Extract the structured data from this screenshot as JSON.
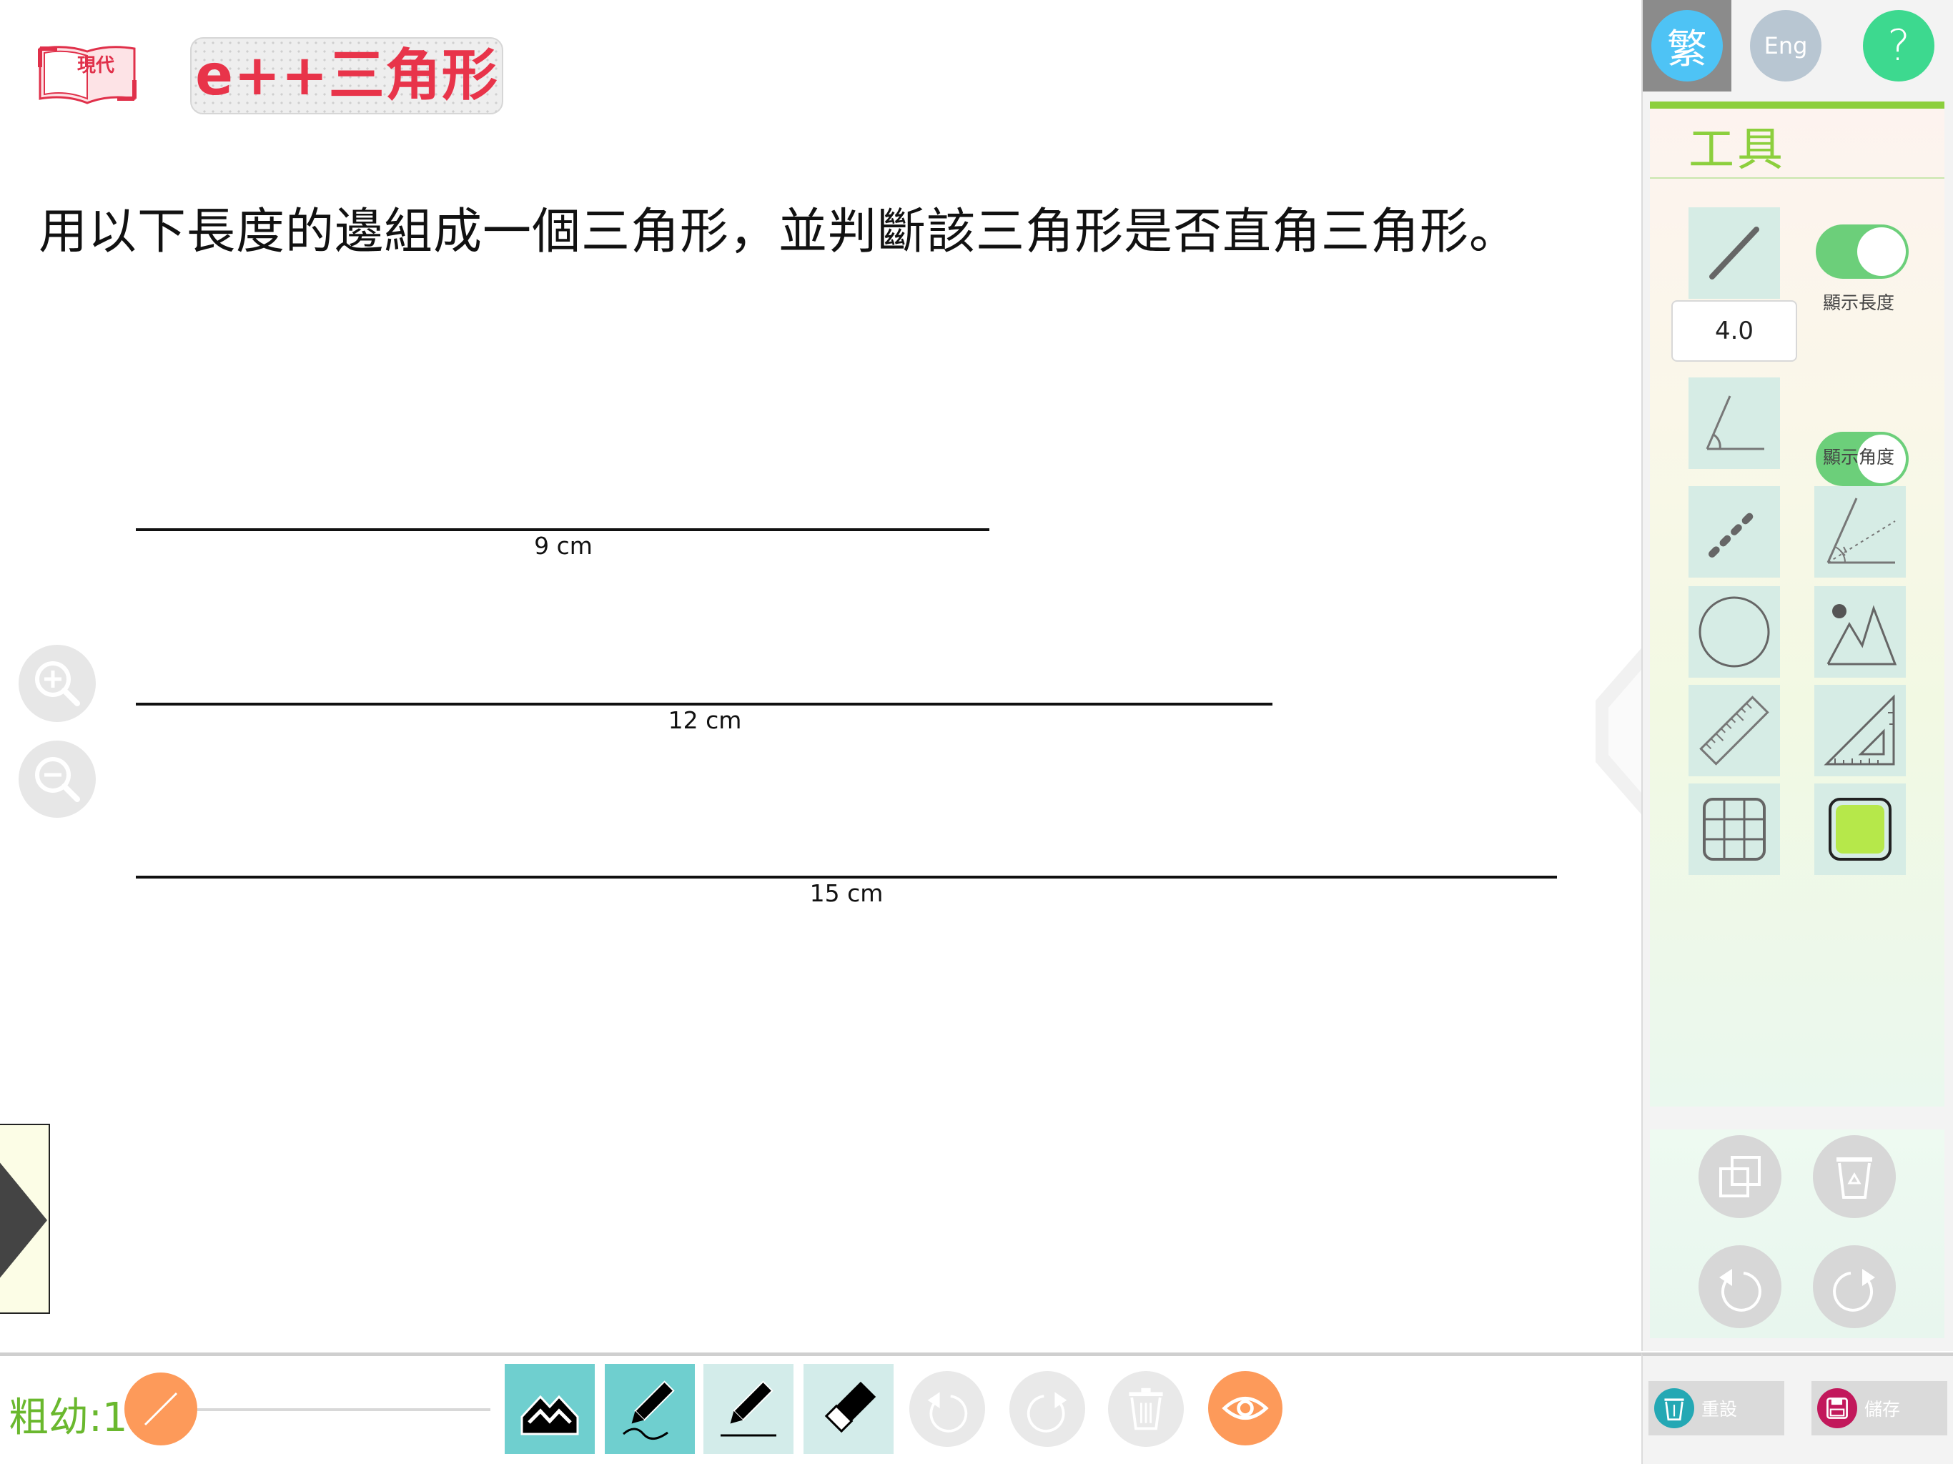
{
  "header": {
    "publisher_logo_text": "現代",
    "app_title_prefix": "e++",
    "app_title_main": "三角形"
  },
  "question": "用以下長度的邊組成一個三角形，並判斷該三角形是否直角三角形。",
  "segments": [
    {
      "label": "9 cm",
      "length_cm": 9
    },
    {
      "label": "12 cm",
      "length_cm": 12
    },
    {
      "label": "15 cm",
      "length_cm": 15
    }
  ],
  "language": {
    "traditional": "繁",
    "english": "Eng",
    "help": "?"
  },
  "tools_panel": {
    "title": "工具",
    "line_length_value": "4.0",
    "show_length_label": "顯示長度",
    "show_length_on": true,
    "show_angle_label": "顯示角度",
    "show_angle_on": true,
    "tools": [
      "line-segment-icon",
      "angle-icon",
      "dashed-line-icon",
      "angle-bisector-icon",
      "circle-icon",
      "point-triangle-icon",
      "ruler-icon",
      "set-square-icon",
      "grid-icon",
      "fill-color-icon"
    ],
    "fill_color": "#b6e84a"
  },
  "actions": {
    "copy": "copy-icon",
    "recycle": "recycle-bin-icon",
    "undo": "undo-icon",
    "redo": "redo-icon",
    "reset_label": "重設",
    "save_label": "儲存"
  },
  "bottom_toolbar": {
    "thickness_label": "粗幼:1",
    "thickness_value": 1,
    "tools": [
      "shape-fill-icon",
      "pen-icon",
      "pencil-icon",
      "eraser-icon"
    ],
    "active_tool": "pen-icon"
  },
  "colors": {
    "accent_green": "#8ccf3d",
    "accent_orange": "#fd9a5a",
    "toggle_green": "#6ccf7a",
    "lang_blue": "#4ec3f5",
    "help_green": "#3dd98f",
    "reset_teal": "#24a8b4",
    "save_magenta": "#c2185b"
  }
}
